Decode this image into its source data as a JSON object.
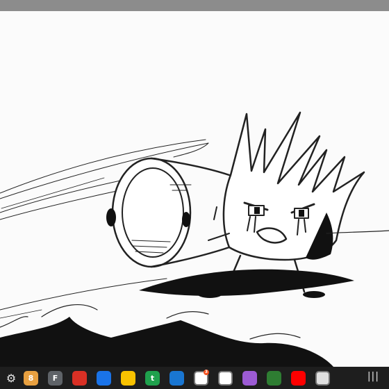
{
  "shelf": {
    "launcher_icon": "gear-icon",
    "apps": [
      {
        "id": "app-1",
        "icon": "numeral-8-icon",
        "glyph": "8",
        "color": "#e8a040"
      },
      {
        "id": "app-2",
        "icon": "file-icon",
        "glyph": "F",
        "color": "#5f6368"
      },
      {
        "id": "app-3",
        "icon": "book-icon",
        "glyph": "",
        "color": "#d93025"
      },
      {
        "id": "app-4",
        "icon": "grid-icon",
        "glyph": "",
        "color": "#1a73e8"
      },
      {
        "id": "app-5",
        "icon": "folder-icon",
        "glyph": "",
        "color": "#f9c200"
      },
      {
        "id": "app-6",
        "icon": "t-icon",
        "glyph": "t",
        "color": "#1fa14d"
      },
      {
        "id": "app-7",
        "icon": "chat-bubble-icon",
        "glyph": "",
        "color": "#1976d2"
      },
      {
        "id": "app-8",
        "icon": "chrome-icon",
        "glyph": "",
        "color": "#ffffff",
        "badge": "3"
      },
      {
        "id": "app-9",
        "icon": "camera-icon",
        "glyph": "",
        "color": "#ffffff"
      },
      {
        "id": "app-10",
        "icon": "cube-icon",
        "glyph": "",
        "color": "#9c5bd4"
      },
      {
        "id": "app-11",
        "icon": "game-icon",
        "glyph": "",
        "color": "#2e7d32"
      },
      {
        "id": "app-12",
        "icon": "video-player-icon",
        "glyph": "",
        "color": "#ff0000"
      },
      {
        "id": "app-13",
        "icon": "smiley-icon",
        "glyph": "",
        "color": "#e0e0e0"
      }
    ],
    "overview_icon": "overview-icon",
    "overview_glyph": "|||"
  }
}
